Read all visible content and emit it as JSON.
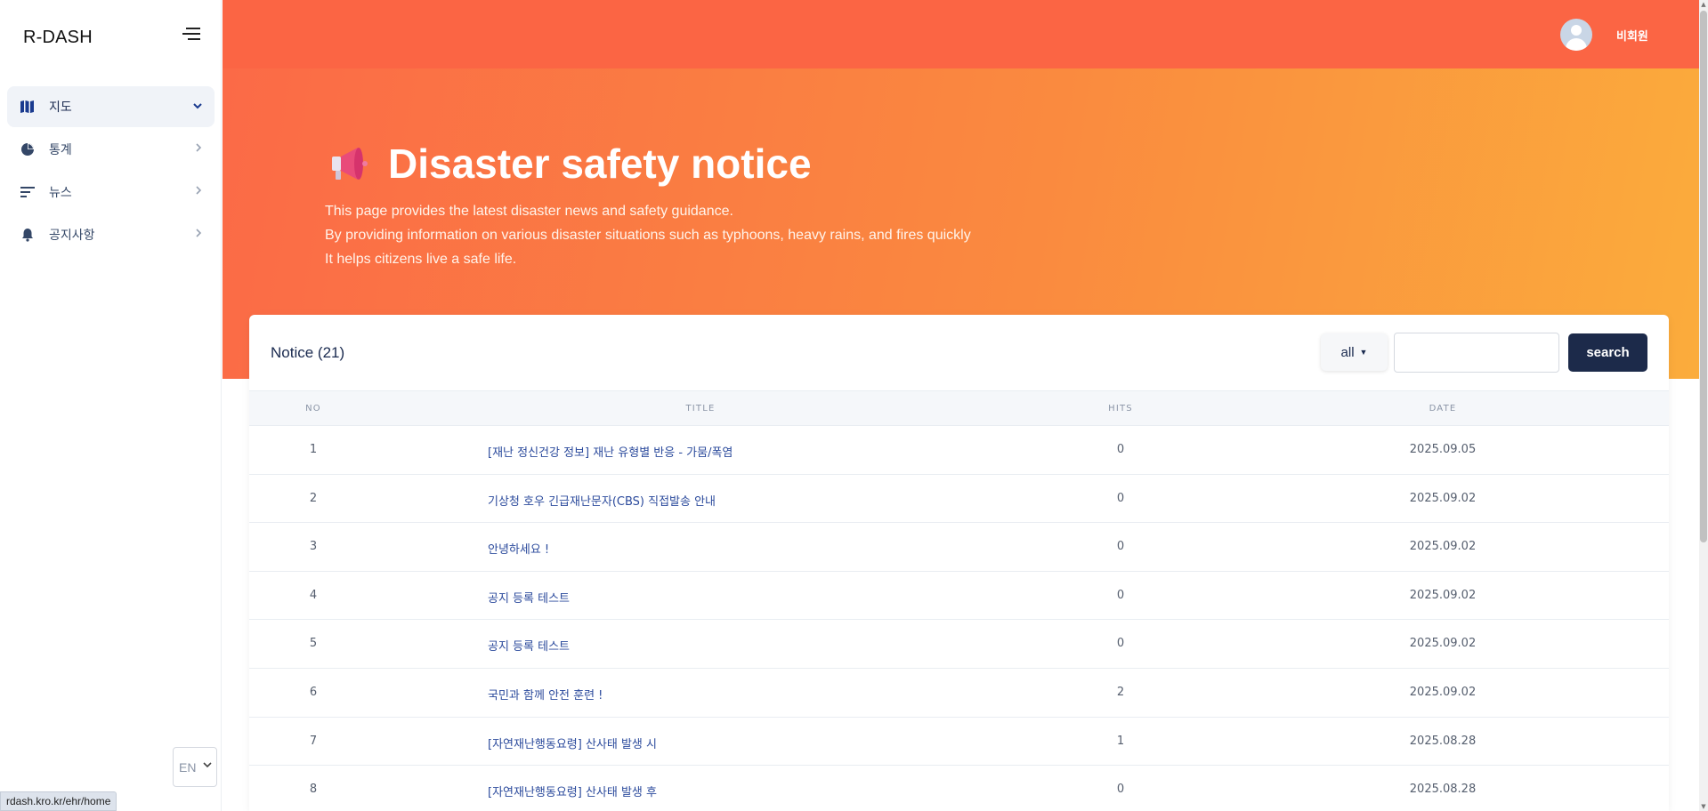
{
  "app": {
    "brand": "R-DASH"
  },
  "sidebar": {
    "items": [
      {
        "label": "지도",
        "icon": "map-icon"
      },
      {
        "label": "통계",
        "icon": "pie-chart-icon"
      },
      {
        "label": "뉴스",
        "icon": "news-icon"
      },
      {
        "label": "공지사항",
        "icon": "bell-icon"
      }
    ],
    "active_index": 0,
    "language": "EN"
  },
  "topbar": {
    "user_name": "비회원"
  },
  "hero": {
    "title": "Disaster safety notice",
    "desc": [
      "This page provides the latest disaster news and safety guidance.",
      "By providing information on various disaster situations such as typhoons, heavy rains, and fires quickly",
      "It helps citizens live a safe life."
    ]
  },
  "notice": {
    "title": "Notice (21)",
    "filter_label": "all",
    "search_placeholder": "",
    "search_button": "search",
    "columns": [
      "NO",
      "TITLE",
      "HITS",
      "DATE"
    ],
    "rows": [
      {
        "no": "1",
        "title": "[재난 정신건강 정보] 재난 유형별 반응 - 가뭄/폭염",
        "hits": "0",
        "date": "2025.09.05"
      },
      {
        "no": "2",
        "title": "기상청 호우 긴급재난문자(CBS) 직접발송 안내",
        "hits": "0",
        "date": "2025.09.02"
      },
      {
        "no": "3",
        "title": "안녕하세요 !",
        "hits": "0",
        "date": "2025.09.02"
      },
      {
        "no": "4",
        "title": "공지 등록 테스트",
        "hits": "0",
        "date": "2025.09.02"
      },
      {
        "no": "5",
        "title": "공지 등록 테스트",
        "hits": "0",
        "date": "2025.09.02"
      },
      {
        "no": "6",
        "title": "국민과 함께 안전 훈련 !",
        "hits": "2",
        "date": "2025.09.02"
      },
      {
        "no": "7",
        "title": "[자연재난행동요령] 산사태 발생 시",
        "hits": "1",
        "date": "2025.08.28"
      },
      {
        "no": "8",
        "title": "[자연재난행동요령] 산사태 발생 후",
        "hits": "0",
        "date": "2025.08.28"
      }
    ]
  },
  "status_bar": {
    "url": "rdash.kro.kr/ehr/home"
  },
  "colors": {
    "topbar": "#fb6544",
    "hero_start": "#fb6a47",
    "hero_end": "#fbac3c",
    "search_button": "#1c2a4a",
    "link": "#2b4a9c"
  }
}
